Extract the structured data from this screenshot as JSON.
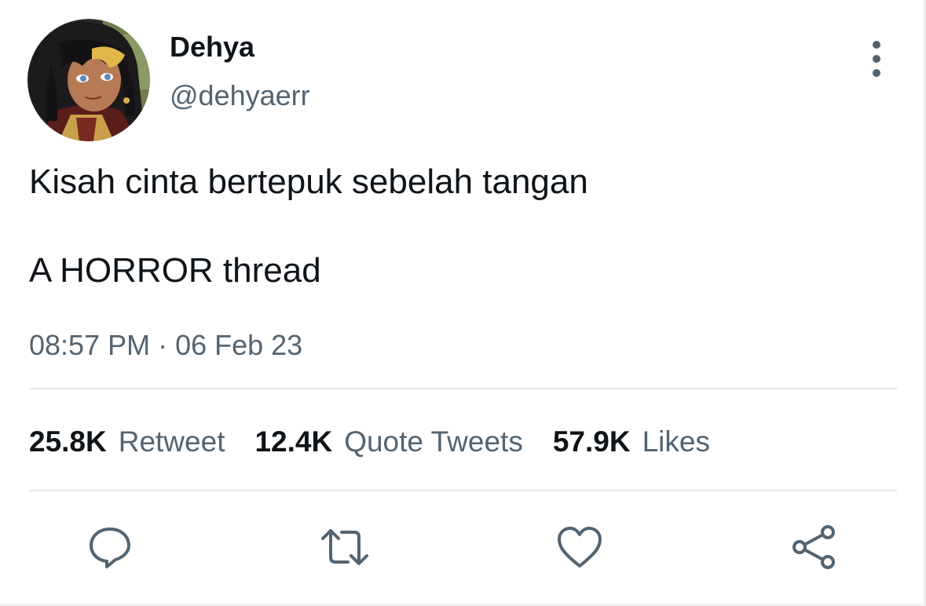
{
  "tweet": {
    "author": {
      "display_name": "Dehya",
      "handle": "@dehyaerr"
    },
    "text_lines": [
      "Kisah cinta bertepuk sebelah tangan",
      "A HORROR thread"
    ],
    "timestamp": "08:57 PM · 06 Feb 23"
  },
  "stats": [
    {
      "count": "25.8K",
      "label": "Retweet"
    },
    {
      "count": "12.4K",
      "label": "Quote Tweets"
    },
    {
      "count": "57.9K",
      "label": "Likes"
    }
  ],
  "actions": {
    "reply_icon": "speech-bubble-icon",
    "retweet_icon": "retweet-arrows-icon",
    "like_icon": "heart-icon",
    "share_icon": "share-nodes-icon"
  },
  "colors": {
    "primary_text": "#0f1419",
    "secondary_text": "#536471",
    "divider": "#e6e9eb",
    "icon": "#536471"
  }
}
